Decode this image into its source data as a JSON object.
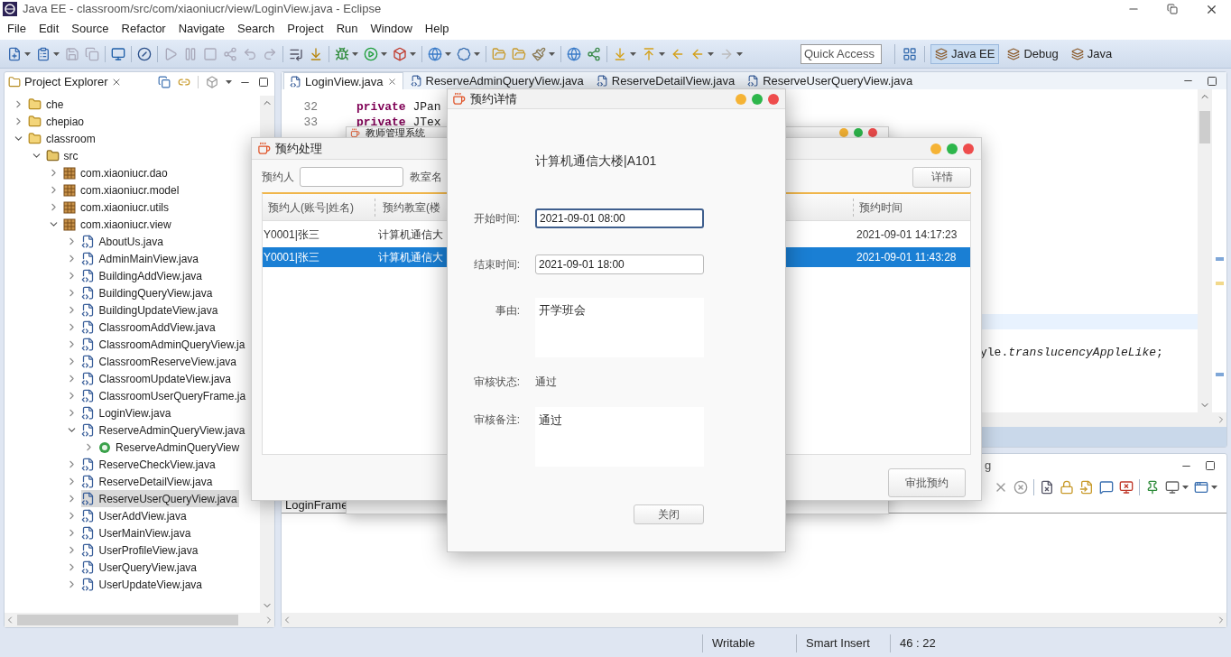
{
  "window": {
    "title": "Java EE - classroom/src/com/xiaoniucr/view/LoginView.java - Eclipse"
  },
  "menu": [
    "File",
    "Edit",
    "Source",
    "Refactor",
    "Navigate",
    "Search",
    "Project",
    "Run",
    "Window",
    "Help"
  ],
  "toolbar": {
    "quick_access": {
      "placeholder": "Quick Access"
    },
    "perspectives": [
      {
        "label": "Java EE",
        "selected": true
      },
      {
        "label": "Debug",
        "selected": false
      },
      {
        "label": "Java",
        "selected": false
      }
    ]
  },
  "project_explorer": {
    "title": "Project Explorer",
    "tree": [
      {
        "label": "che",
        "kind": "project",
        "expanded": false,
        "selected": false
      },
      {
        "label": "chepiao",
        "kind": "project",
        "expanded": false,
        "selected": false
      },
      {
        "label": "classroom",
        "kind": "project",
        "expanded": true,
        "selected": false,
        "children": [
          {
            "label": "src",
            "kind": "source_folder",
            "expanded": true,
            "selected": false,
            "children": [
              {
                "label": "com.xiaoniucr.dao",
                "kind": "package",
                "expanded": false,
                "selected": false
              },
              {
                "label": "com.xiaoniucr.model",
                "kind": "package",
                "expanded": false,
                "selected": false
              },
              {
                "label": "com.xiaoniucr.utils",
                "kind": "package",
                "expanded": false,
                "selected": false
              },
              {
                "label": "com.xiaoniucr.view",
                "kind": "package",
                "expanded": true,
                "selected": false,
                "children": [
                  {
                    "label": "AboutUs.java",
                    "kind": "java_file",
                    "expanded": false,
                    "selected": false
                  },
                  {
                    "label": "AdminMainView.java",
                    "kind": "java_file",
                    "expanded": false,
                    "selected": false
                  },
                  {
                    "label": "BuildingAddView.java",
                    "kind": "java_file",
                    "expanded": false,
                    "selected": false
                  },
                  {
                    "label": "BuildingQueryView.java",
                    "kind": "java_file",
                    "expanded": false,
                    "selected": false
                  },
                  {
                    "label": "BuildingUpdateView.java",
                    "kind": "java_file",
                    "expanded": false,
                    "selected": false
                  },
                  {
                    "label": "ClassroomAddView.java",
                    "kind": "java_file",
                    "expanded": false,
                    "selected": false
                  },
                  {
                    "label": "ClassroomAdminQueryView.ja",
                    "kind": "java_file",
                    "expanded": false,
                    "selected": false
                  },
                  {
                    "label": "ClassroomReserveView.java",
                    "kind": "java_file",
                    "expanded": false,
                    "selected": false
                  },
                  {
                    "label": "ClassroomUpdateView.java",
                    "kind": "java_file",
                    "expanded": false,
                    "selected": false
                  },
                  {
                    "label": "ClassroomUserQueryFrame.ja",
                    "kind": "java_file",
                    "expanded": false,
                    "selected": false
                  },
                  {
                    "label": "LoginView.java",
                    "kind": "java_file",
                    "expanded": false,
                    "selected": false
                  },
                  {
                    "label": "ReserveAdminQueryView.java",
                    "kind": "java_file",
                    "expanded": true,
                    "selected": false,
                    "children": [
                      {
                        "label": "ReserveAdminQueryView",
                        "kind": "class",
                        "expanded": false,
                        "selected": false
                      }
                    ]
                  },
                  {
                    "label": "ReserveCheckView.java",
                    "kind": "java_file",
                    "expanded": false,
                    "selected": false
                  },
                  {
                    "label": "ReserveDetailView.java",
                    "kind": "java_file",
                    "expanded": false,
                    "selected": false
                  },
                  {
                    "label": "ReserveUserQueryView.java",
                    "kind": "java_file",
                    "expanded": false,
                    "selected": true
                  },
                  {
                    "label": "UserAddView.java",
                    "kind": "java_file",
                    "expanded": false,
                    "selected": false
                  },
                  {
                    "label": "UserMainView.java",
                    "kind": "java_file",
                    "expanded": false,
                    "selected": false
                  },
                  {
                    "label": "UserProfileView.java",
                    "kind": "java_file",
                    "expanded": false,
                    "selected": false
                  },
                  {
                    "label": "UserQueryView.java",
                    "kind": "java_file",
                    "expanded": false,
                    "selected": false
                  },
                  {
                    "label": "UserUpdateView.java",
                    "kind": "java_file",
                    "expanded": false,
                    "selected": false
                  }
                ]
              }
            ]
          }
        ]
      }
    ]
  },
  "editor": {
    "tabs": [
      {
        "label": "LoginView.java",
        "selected": true
      },
      {
        "label": "ReserveAdminQueryView.java",
        "selected": false
      },
      {
        "label": "ReserveDetailView.java",
        "selected": false
      },
      {
        "label": "ReserveUserQueryView.java",
        "selected": false
      }
    ],
    "lines": [
      {
        "number": "32",
        "keyword": "private",
        "text": "JPan"
      },
      {
        "number": "33",
        "keyword": "private",
        "text": "JTex"
      }
    ],
    "fragment": "yle.*translucencyAppleLike*;"
  },
  "bottom_panel": {
    "tab": "g",
    "console": "LoginFrame"
  },
  "status_bar": [
    "Writable",
    "Smart Insert",
    "46 : 22"
  ],
  "background_window": {
    "title": "教师管理系统"
  },
  "reserve_window": {
    "title": "预约处理",
    "person_label": "预约人",
    "room_label": "教室名",
    "detail_button": "详情",
    "columns": [
      "预约人(账号|姓名)",
      "预约教室(楼",
      "预约时间"
    ],
    "rows": [
      {
        "cells": [
          "Y0001|张三",
          "计算机通信大",
          "2021-09-01 14:17:23"
        ],
        "selected": false
      },
      {
        "cells": [
          "Y0001|张三",
          "计算机通信大",
          "2021-09-01 11:43:28"
        ],
        "selected": true
      }
    ],
    "approve_button": "审批预约"
  },
  "detail_window": {
    "title": "预约详情",
    "room": "计算机通信大楼|A101",
    "start": {
      "label": "开始时间:",
      "value": "2021-09-01 08:00",
      "focused": true
    },
    "end": {
      "label": "结束时间:",
      "value": "2021-09-01 18:00",
      "focused": false
    },
    "reason": {
      "label": "事由:",
      "value": "开学班会"
    },
    "status": {
      "label": "审核状态:",
      "value": "通过"
    },
    "remark": {
      "label": "审核备注:",
      "value": "通过"
    },
    "close_button": "关闭"
  }
}
